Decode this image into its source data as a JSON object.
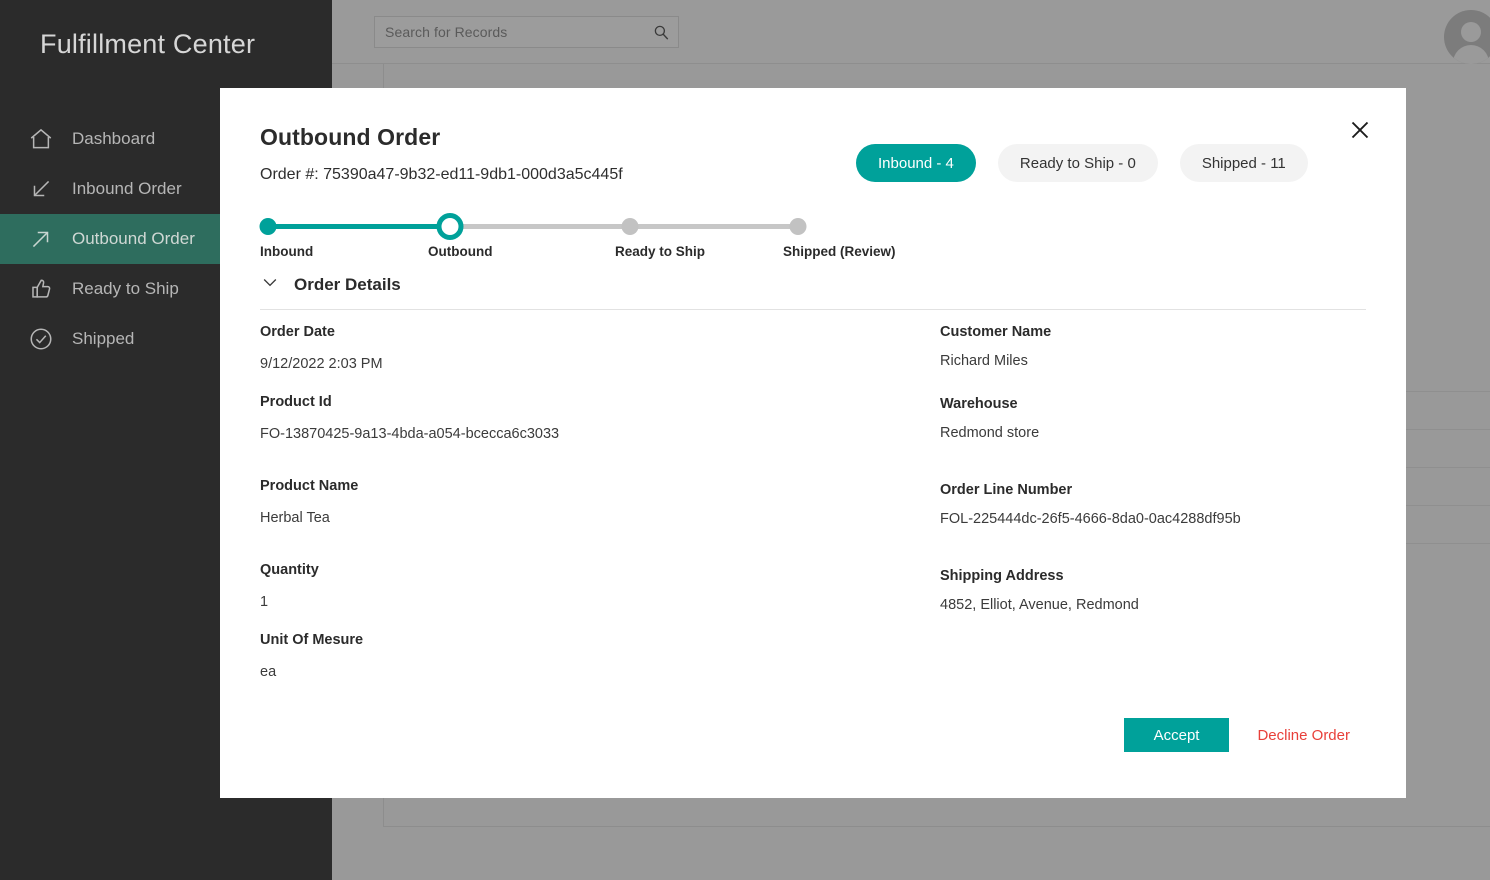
{
  "app": {
    "brand": "Fulfillment Center",
    "accent_color": "#00a19a",
    "sidebar_bg": "#2b2b2b",
    "active_nav_bg": "#2e6d5e",
    "decline_color": "#e8403a"
  },
  "sidebar": {
    "items": [
      {
        "label": "Dashboard",
        "icon": "home-icon",
        "active": false
      },
      {
        "label": "Inbound Order",
        "icon": "arrow-down-left-icon",
        "active": false
      },
      {
        "label": "Outbound Order",
        "icon": "arrow-up-right-icon",
        "active": true
      },
      {
        "label": "Ready to Ship",
        "icon": "thumbs-up-icon",
        "active": false
      },
      {
        "label": "Shipped",
        "icon": "check-circle-icon",
        "active": false
      }
    ]
  },
  "background": {
    "search": {
      "placeholder": "Search for Records",
      "value": "",
      "icon": "search-icon"
    },
    "avatar": {
      "icon": "user-avatar-icon"
    }
  },
  "modal": {
    "title": "Outbound Order",
    "order_number_label": "Order #: 75390a47-9b32-ed11-9db1-000d3a5c445f",
    "close_icon": "close-icon",
    "pills": [
      {
        "label": "Inbound - 4",
        "active": true
      },
      {
        "label": "Ready to Ship - 0",
        "active": false
      },
      {
        "label": "Shipped - 11",
        "active": false
      }
    ],
    "stepper": {
      "steps": [
        {
          "label": "Inbound",
          "state": "done"
        },
        {
          "label": "Outbound",
          "state": "current"
        },
        {
          "label": "Ready to Ship",
          "state": "upcoming"
        },
        {
          "label": "Shipped (Review)",
          "state": "upcoming"
        }
      ]
    },
    "section": {
      "title": "Order Details",
      "chevron_icon": "chevron-down-icon",
      "expanded": true
    },
    "fields_left": [
      {
        "label": "Order Date",
        "value": " 9/12/2022 2:03 PM"
      },
      {
        "label": "Product Id",
        "value": "FO-13870425-9a13-4bda-a054-bcecca6c3033"
      },
      {
        "label": "Product Name",
        "value": "Herbal Tea"
      },
      {
        "label": "Quantity",
        "value": "1"
      },
      {
        "label": "Unit Of Mesure",
        "value": "ea"
      }
    ],
    "fields_right": [
      {
        "label": "Customer Name",
        "value": " Richard Miles"
      },
      {
        "label": "Warehouse",
        "value": "Redmond store"
      },
      {
        "label": "Order Line Number",
        "value": "FOL-225444dc-26f5-4666-8da0-0ac4288df95b"
      },
      {
        "label": "Shipping Address",
        "value": "4852, Elliot, Avenue, Redmond"
      }
    ],
    "actions": {
      "accept_label": "Accept",
      "decline_label": "Decline Order"
    }
  }
}
